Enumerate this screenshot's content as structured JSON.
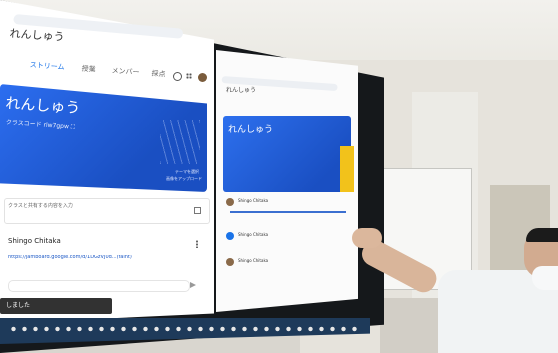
{
  "screen": {
    "left_window": {
      "class_title": "れんしゅう",
      "tabs": [
        "ストリーム",
        "授業",
        "メンバー",
        "採点"
      ],
      "class_code": "クラスコード rlw7gpw ⛶",
      "banner_links": [
        "テーマを選択",
        "画像をアップロード"
      ],
      "share_prompt": "クラスと共有する内容を入力",
      "post_author": "Shingo Chitaka",
      "post_link": "https://jamboard.google.com/d/1DGzVJ0d...(faint)",
      "toast": "しました"
    },
    "right_window": {
      "class_title": "れんしゅう",
      "posts": [
        {
          "author": "Shingo Chitaka"
        },
        {
          "author": "Shingo Chitaka"
        },
        {
          "author": "Shingo Chitaka"
        }
      ]
    }
  },
  "colors": {
    "banner": "#1f5fd6",
    "room_wall": "#e8e6e0",
    "shirt": "#f1f3f4"
  }
}
